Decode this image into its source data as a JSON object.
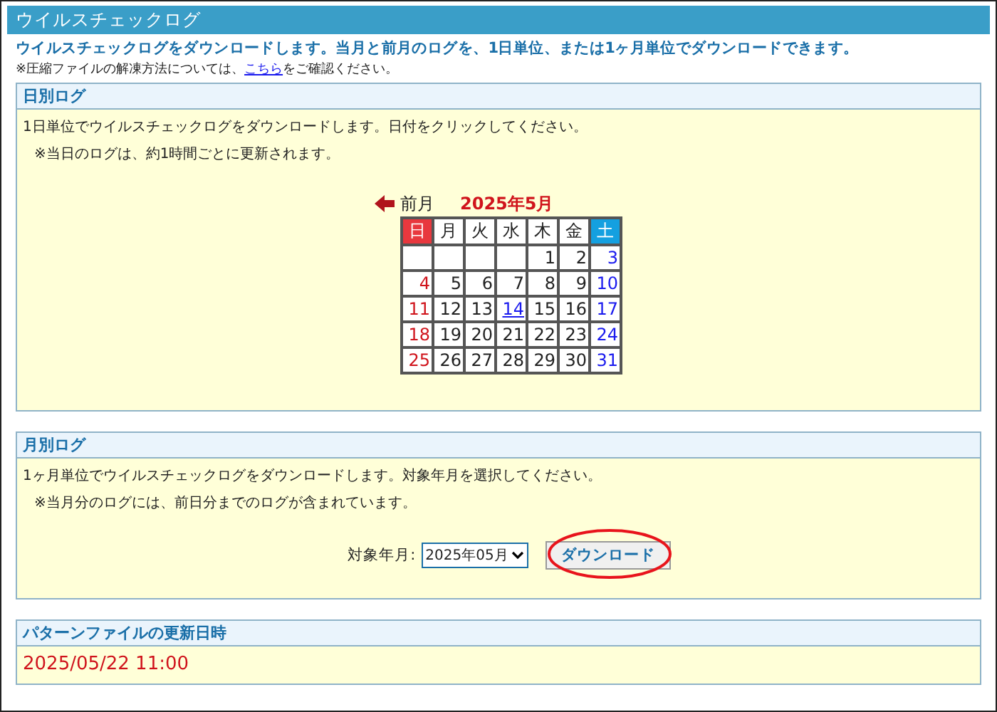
{
  "title": "ウイルスチェックログ",
  "intro": "ウイルスチェックログをダウンロードします。当月と前月のログを、1日単位、または1ヶ月単位でダウンロードできます。",
  "note": {
    "before": "※圧縮ファイルの解凍方法については、",
    "link": "こちら",
    "after": "をご確認ください。"
  },
  "daily": {
    "heading": "日別ログ",
    "description": "1日単位でウイルスチェックログをダウンロードします。日付をクリックしてください。",
    "note": "※当日のログは、約1時間ごとに更新されます。",
    "calendar": {
      "prev_label": "前月",
      "month_label": "2025年5月",
      "headers": [
        {
          "label": "日",
          "kind": "sunday"
        },
        {
          "label": "月",
          "kind": "weekday"
        },
        {
          "label": "火",
          "kind": "weekday"
        },
        {
          "label": "水",
          "kind": "weekday"
        },
        {
          "label": "木",
          "kind": "weekday"
        },
        {
          "label": "金",
          "kind": "weekday"
        },
        {
          "label": "土",
          "kind": "saturday"
        }
      ],
      "weeks": [
        [
          {
            "kind": "empty"
          },
          {
            "kind": "empty"
          },
          {
            "kind": "empty"
          },
          {
            "kind": "empty"
          },
          {
            "day": "1",
            "kind": "weekday",
            "link": false
          },
          {
            "day": "2",
            "kind": "weekday",
            "link": false
          },
          {
            "day": "3",
            "kind": "saturday",
            "link": false
          }
        ],
        [
          {
            "day": "4",
            "kind": "sunday",
            "link": false
          },
          {
            "day": "5",
            "kind": "weekday",
            "link": false
          },
          {
            "day": "6",
            "kind": "weekday",
            "link": false
          },
          {
            "day": "7",
            "kind": "weekday",
            "link": false
          },
          {
            "day": "8",
            "kind": "weekday",
            "link": false
          },
          {
            "day": "9",
            "kind": "weekday",
            "link": false
          },
          {
            "day": "10",
            "kind": "saturday",
            "link": false
          }
        ],
        [
          {
            "day": "11",
            "kind": "sunday",
            "link": false
          },
          {
            "day": "12",
            "kind": "weekday",
            "link": false
          },
          {
            "day": "13",
            "kind": "weekday",
            "link": false
          },
          {
            "day": "14",
            "kind": "weekday",
            "link": true
          },
          {
            "day": "15",
            "kind": "weekday",
            "link": false
          },
          {
            "day": "16",
            "kind": "weekday",
            "link": false
          },
          {
            "day": "17",
            "kind": "saturday",
            "link": false
          }
        ],
        [
          {
            "day": "18",
            "kind": "sunday",
            "link": false
          },
          {
            "day": "19",
            "kind": "weekday",
            "link": false
          },
          {
            "day": "20",
            "kind": "weekday",
            "link": false
          },
          {
            "day": "21",
            "kind": "weekday",
            "link": false
          },
          {
            "day": "22",
            "kind": "weekday",
            "link": false
          },
          {
            "day": "23",
            "kind": "weekday",
            "link": false
          },
          {
            "day": "24",
            "kind": "saturday",
            "link": false
          }
        ],
        [
          {
            "day": "25",
            "kind": "sunday",
            "link": false
          },
          {
            "day": "26",
            "kind": "weekday",
            "link": false
          },
          {
            "day": "27",
            "kind": "weekday",
            "link": false
          },
          {
            "day": "28",
            "kind": "weekday",
            "link": false
          },
          {
            "day": "29",
            "kind": "weekday",
            "link": false
          },
          {
            "day": "30",
            "kind": "weekday",
            "link": false
          },
          {
            "day": "31",
            "kind": "saturday",
            "link": false
          }
        ]
      ]
    }
  },
  "monthly": {
    "heading": "月別ログ",
    "description": "1ヶ月単位でウイルスチェックログをダウンロードします。対象年月を選択してください。",
    "note": "※当月分のログには、前日分までのログが含まれています。",
    "select_label": "対象年月:",
    "select_value": "2025年05月",
    "button": {
      "label": "ダウンロード",
      "highlighted": true
    }
  },
  "pattern": {
    "heading": "パターンファイルの更新日時",
    "value": "2025/05/22 11:00"
  }
}
